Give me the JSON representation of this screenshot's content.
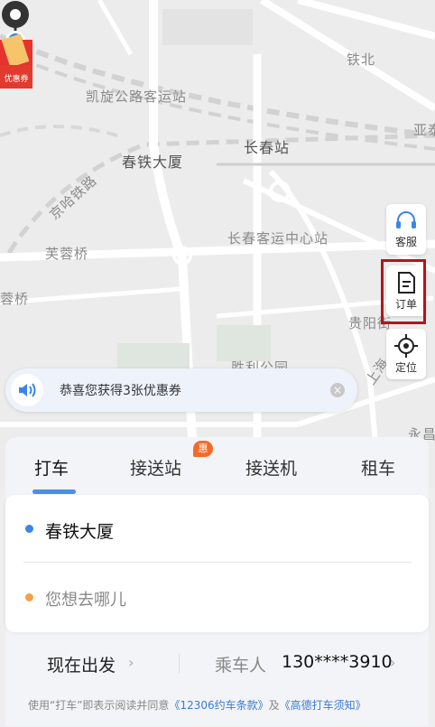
{
  "map": {
    "labels": [
      {
        "id": "tiebei",
        "text": "铁北"
      },
      {
        "id": "kaixuan",
        "text": "凯旋公路客运站"
      },
      {
        "id": "changchun_station",
        "text": "长春站"
      },
      {
        "id": "chuntie",
        "text": "春铁大厦"
      },
      {
        "id": "jingha",
        "text": "京哈铁路"
      },
      {
        "id": "furong",
        "text": "芙蓉桥"
      },
      {
        "id": "keyun",
        "text": "长春客运中心站"
      },
      {
        "id": "rongqiao",
        "text": "蓉桥"
      },
      {
        "id": "guiyang",
        "text": "贵阳街"
      },
      {
        "id": "shengli",
        "text": "胜利公园"
      },
      {
        "id": "shanghai",
        "text": "上海"
      },
      {
        "id": "yongchang",
        "text": "永昌"
      },
      {
        "id": "ya",
        "text": "亚泰"
      }
    ]
  },
  "promo": {
    "label": "优惠券"
  },
  "side_buttons": {
    "service": "客服",
    "orders": "订单",
    "locate": "定位"
  },
  "toast": {
    "text": "恭喜您获得3张优惠券"
  },
  "tabs": {
    "taxi": "打车",
    "station": "接送站",
    "station_badge": "惠",
    "airport": "接送机",
    "rental": "租车"
  },
  "route": {
    "from": "春铁大厦",
    "to_placeholder": "您想去哪儿"
  },
  "bottom": {
    "depart": "现在出发",
    "passenger_label": "乘车人",
    "passenger_phone": "130****3910"
  },
  "agreement": {
    "prefix": "使用“打车”即表示阅读并同意",
    "link1": "《12306约车条款》",
    "and": "及",
    "link2": "《高德打车须知》"
  },
  "colors": {
    "accent": "#4a90e2",
    "badge": "#f36a2a",
    "highlight": "#b3151b"
  }
}
